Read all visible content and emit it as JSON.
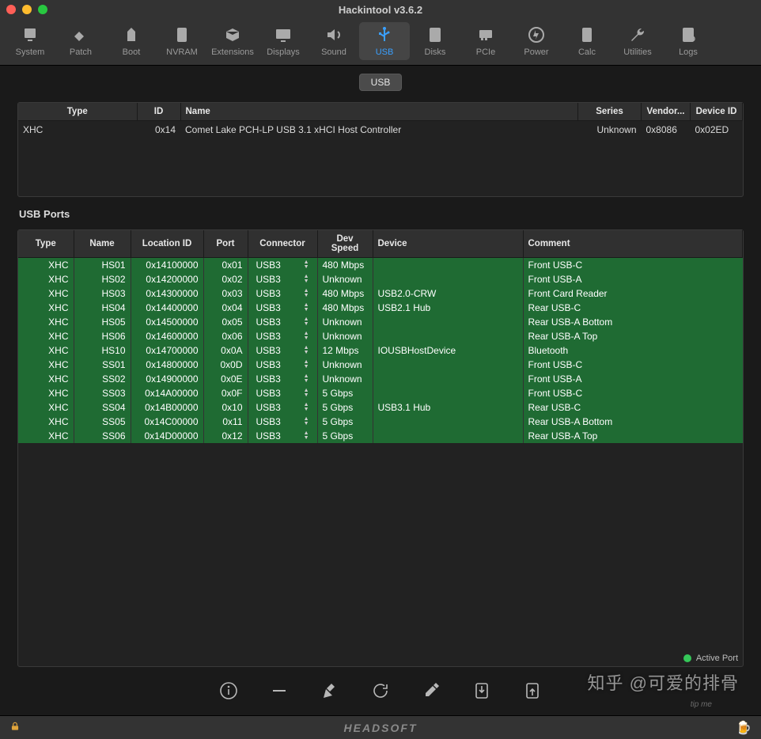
{
  "title": "Hackintool v3.6.2",
  "toolbar": [
    {
      "key": "system",
      "label": "System"
    },
    {
      "key": "patch",
      "label": "Patch"
    },
    {
      "key": "boot",
      "label": "Boot"
    },
    {
      "key": "nvram",
      "label": "NVRAM"
    },
    {
      "key": "extensions",
      "label": "Extensions"
    },
    {
      "key": "displays",
      "label": "Displays"
    },
    {
      "key": "sound",
      "label": "Sound"
    },
    {
      "key": "usb",
      "label": "USB",
      "active": true
    },
    {
      "key": "disks",
      "label": "Disks"
    },
    {
      "key": "pcie",
      "label": "PCIe"
    },
    {
      "key": "power",
      "label": "Power"
    },
    {
      "key": "calc",
      "label": "Calc"
    },
    {
      "key": "utilities",
      "label": "Utilities"
    },
    {
      "key": "logs",
      "label": "Logs"
    }
  ],
  "tab_chip": "USB",
  "controllers": {
    "headers": {
      "type": "Type",
      "id": "ID",
      "name": "Name",
      "series": "Series",
      "vendor": "Vendor...",
      "device": "Device ID"
    },
    "rows": [
      {
        "type": "XHC",
        "id": "0x14",
        "name": "Comet Lake PCH-LP USB 3.1 xHCI Host Controller",
        "series": "Unknown",
        "vendor": "0x8086",
        "device": "0x02ED"
      }
    ]
  },
  "ports_label": "USB Ports",
  "ports": {
    "headers": {
      "type": "Type",
      "name": "Name",
      "loc": "Location ID",
      "port": "Port",
      "connector": "Connector",
      "speed": "Dev Speed",
      "device": "Device",
      "comment": "Comment"
    },
    "rows": [
      {
        "type": "XHC",
        "name": "HS01",
        "loc": "0x14100000",
        "port": "0x01",
        "connector": "USB3",
        "speed": "480 Mbps",
        "device": "",
        "comment": "Front USB-C"
      },
      {
        "type": "XHC",
        "name": "HS02",
        "loc": "0x14200000",
        "port": "0x02",
        "connector": "USB3",
        "speed": "Unknown",
        "device": "",
        "comment": "Front USB-A"
      },
      {
        "type": "XHC",
        "name": "HS03",
        "loc": "0x14300000",
        "port": "0x03",
        "connector": "USB3",
        "speed": "480 Mbps",
        "device": "USB2.0-CRW",
        "comment": "Front Card Reader"
      },
      {
        "type": "XHC",
        "name": "HS04",
        "loc": "0x14400000",
        "port": "0x04",
        "connector": "USB3",
        "speed": "480 Mbps",
        "device": "USB2.1 Hub",
        "comment": "Rear USB-C"
      },
      {
        "type": "XHC",
        "name": "HS05",
        "loc": "0x14500000",
        "port": "0x05",
        "connector": "USB3",
        "speed": "Unknown",
        "device": "",
        "comment": "Rear USB-A Bottom"
      },
      {
        "type": "XHC",
        "name": "HS06",
        "loc": "0x14600000",
        "port": "0x06",
        "connector": "USB3",
        "speed": "Unknown",
        "device": "",
        "comment": "Rear USB-A Top"
      },
      {
        "type": "XHC",
        "name": "HS10",
        "loc": "0x14700000",
        "port": "0x0A",
        "connector": "USB3",
        "speed": "12 Mbps",
        "device": "IOUSBHostDevice",
        "comment": "Bluetooth"
      },
      {
        "type": "XHC",
        "name": "SS01",
        "loc": "0x14800000",
        "port": "0x0D",
        "connector": "USB3",
        "speed": "Unknown",
        "device": "",
        "comment": "Front USB-C"
      },
      {
        "type": "XHC",
        "name": "SS02",
        "loc": "0x14900000",
        "port": "0x0E",
        "connector": "USB3",
        "speed": "Unknown",
        "device": "",
        "comment": "Front USB-A"
      },
      {
        "type": "XHC",
        "name": "SS03",
        "loc": "0x14A00000",
        "port": "0x0F",
        "connector": "USB3",
        "speed": "5 Gbps",
        "device": "",
        "comment": "Front USB-C"
      },
      {
        "type": "XHC",
        "name": "SS04",
        "loc": "0x14B00000",
        "port": "0x10",
        "connector": "USB3",
        "speed": "5 Gbps",
        "device": "USB3.1 Hub",
        "comment": "Rear USB-C"
      },
      {
        "type": "XHC",
        "name": "SS05",
        "loc": "0x14C00000",
        "port": "0x11",
        "connector": "USB3",
        "speed": "5 Gbps",
        "device": "",
        "comment": "Rear USB-A Bottom"
      },
      {
        "type": "XHC",
        "name": "SS06",
        "loc": "0x14D00000",
        "port": "0x12",
        "connector": "USB3",
        "speed": "5 Gbps",
        "device": "",
        "comment": "Rear USB-A Top"
      }
    ]
  },
  "legend": {
    "active": "Active Port"
  },
  "footer": {
    "brand": "HEADSOFT"
  },
  "watermark": "知乎 @可爱的排骨",
  "watermark_sub": "tip me"
}
